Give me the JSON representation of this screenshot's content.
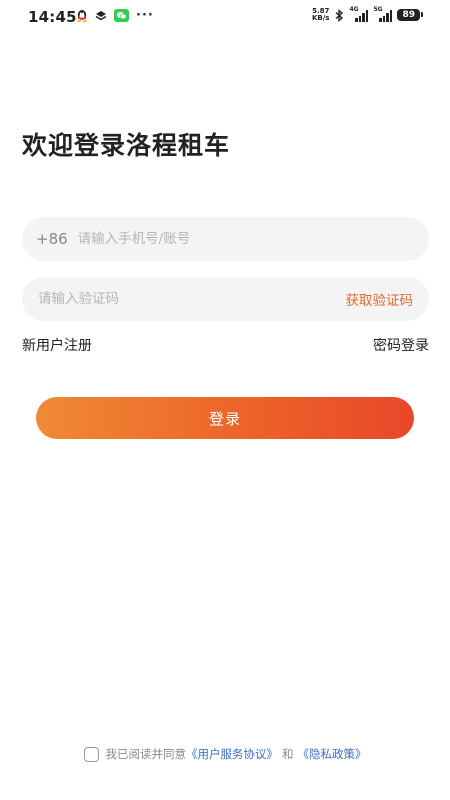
{
  "status_bar": {
    "time": "14:45",
    "net_speed_value": "5.87",
    "net_speed_unit": "KB/s",
    "sim1_label": "4G",
    "sim2_label": "5G",
    "battery": "89",
    "more": "···"
  },
  "title": "欢迎登录洛程租车",
  "phone_field": {
    "prefix": "+86",
    "placeholder": "请输入手机号/账号",
    "value": ""
  },
  "code_field": {
    "placeholder": "请输入验证码",
    "value": "",
    "get_code_label": "获取验证码"
  },
  "links": {
    "register": "新用户注册",
    "password_login": "密码登录"
  },
  "login_button": "登录",
  "agreement": {
    "checked": false,
    "prefix": "我已阅读并同意",
    "user_agreement": "《用户服务协议》",
    "and": "和",
    "privacy_policy": "《隐私政策》"
  },
  "colors": {
    "accent": "#e06a2c",
    "button_gradient_start": "#f08a35",
    "button_gradient_end": "#e8472a",
    "link": "#3a6fc7"
  }
}
